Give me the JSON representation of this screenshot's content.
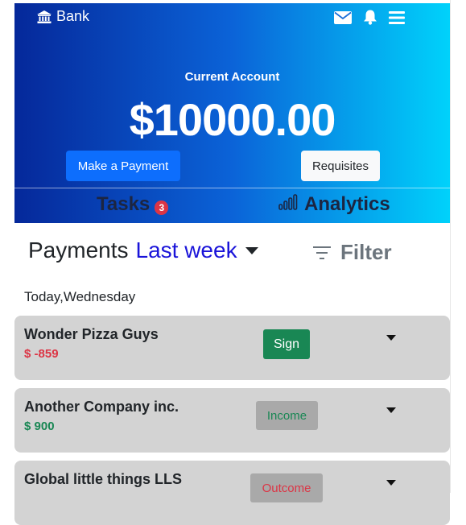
{
  "header": {
    "brand": "Bank",
    "brand_icon": "bank-icon",
    "icons": [
      "envelope-icon",
      "bell-icon",
      "menu-icon"
    ],
    "account_label": "Current Account",
    "balance": "$10000.00",
    "pay_button": "Make a Payment",
    "requisites_button": "Requisites",
    "colors": {
      "gradient_start": "#05289a",
      "gradient_end": "#00d2fb",
      "primary": "#0d6efd"
    }
  },
  "tabs": {
    "tasks_label": "Tasks",
    "tasks_badge": "3",
    "analytics_label": "Analytics",
    "analytics_icon": "bar-chart-icon"
  },
  "payments": {
    "title": "Payments",
    "period": "Last week",
    "filter_label": "Filter",
    "day_label": "Today,Wednesday",
    "items": [
      {
        "name": "Wonder Pizza Guys",
        "amount": "$ -859",
        "action": "Sign",
        "amount_color": "#dc3545"
      },
      {
        "name": "Another Company inc.",
        "amount": "$ 900",
        "action": "Income",
        "amount_color": "#198754"
      },
      {
        "name": "Global little things LLS",
        "amount": "",
        "action": "Outcome"
      }
    ]
  }
}
